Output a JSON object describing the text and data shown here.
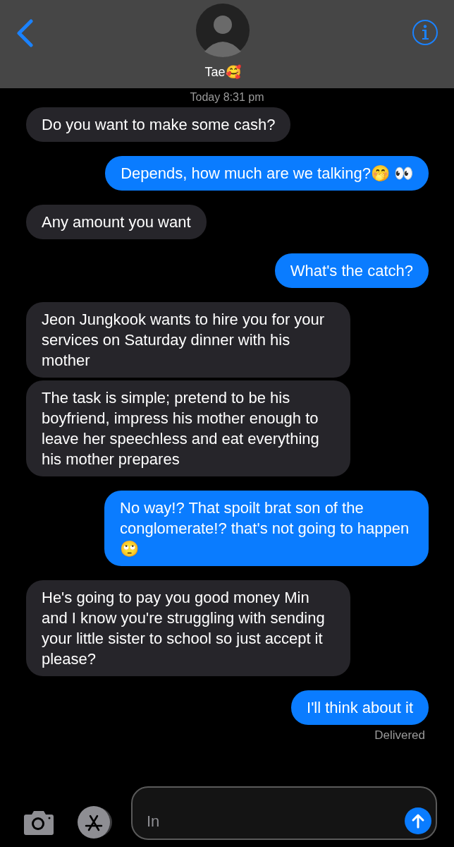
{
  "header": {
    "contact_name": "Tae🥰"
  },
  "timestamp": "Today 8:31 pm",
  "messages": [
    {
      "kind": "received",
      "text": "Do you want to make some cash?"
    },
    {
      "kind": "sent",
      "text": "Depends, how much are we talking?🤭 👀"
    },
    {
      "kind": "received",
      "text": "Any amount you want"
    },
    {
      "kind": "sent",
      "text": "What's the catch?"
    },
    {
      "kind": "received",
      "text": "Jeon Jungkook wants to hire you for your services on Saturday dinner with his mother"
    },
    {
      "kind": "received",
      "text": "The task is simple; pretend to be his boyfriend, impress his mother enough to leave her speechless and eat everything his mother prepares"
    },
    {
      "kind": "sent",
      "text": "No way!? That spoilt brat son of the conglomerate!? that's not going to happen 🙄"
    },
    {
      "kind": "received",
      "text": "He's going to pay you good money Min and I know you're struggling with sending your little sister to school so just accept it please?"
    },
    {
      "kind": "sent",
      "text": "I'll think about it"
    }
  ],
  "delivery_status": "Delivered",
  "composer": {
    "placeholder": "In"
  }
}
